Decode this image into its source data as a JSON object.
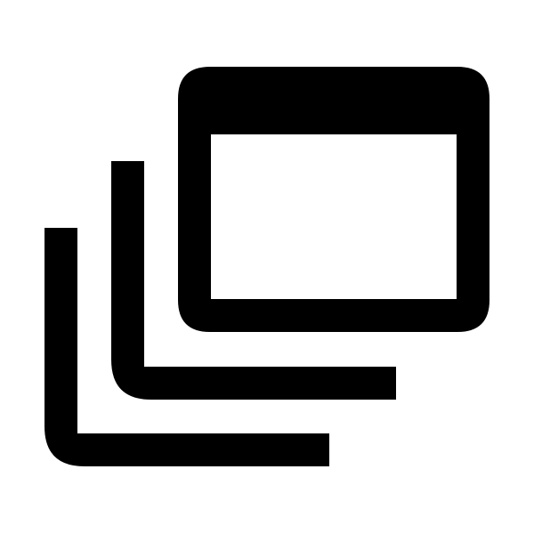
{
  "icon": {
    "name": "stacked-windows-icon",
    "color": "#000000",
    "background": "#ffffff"
  }
}
